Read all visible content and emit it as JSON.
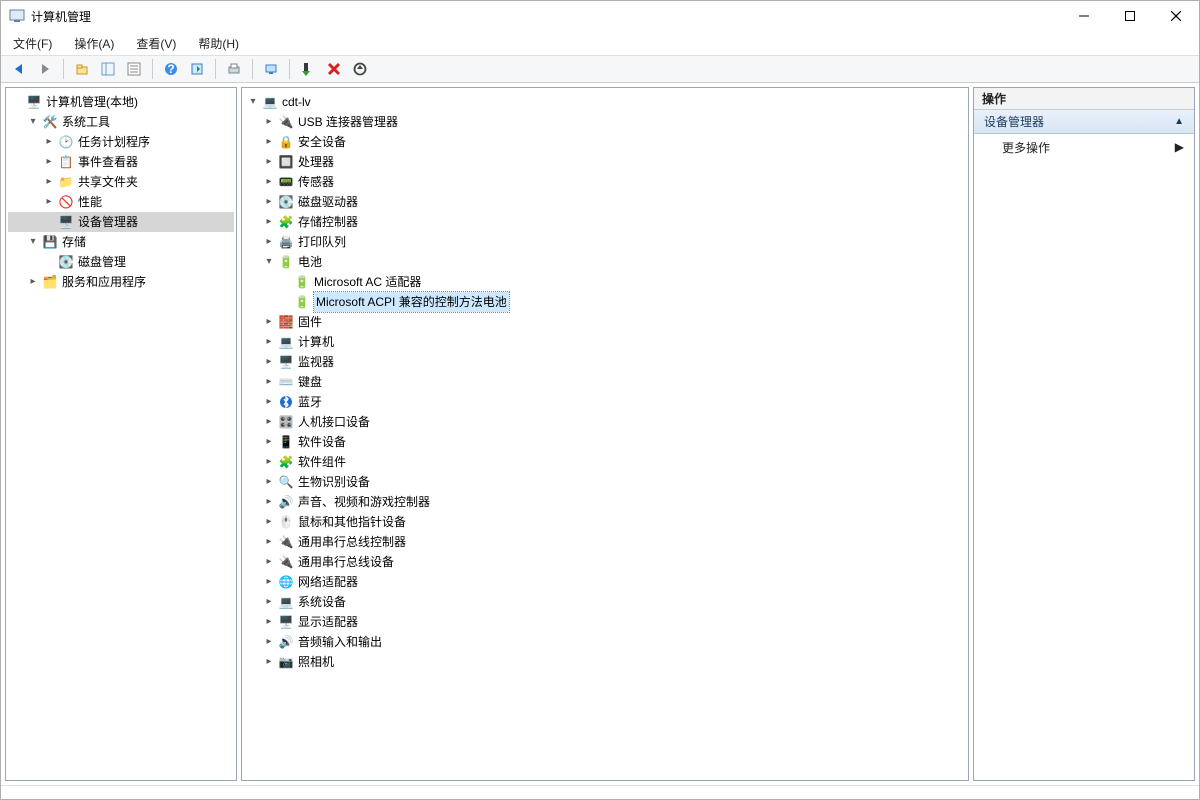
{
  "window": {
    "title": "计算机管理"
  },
  "menu": {
    "file": "文件(F)",
    "action": "操作(A)",
    "view": "查看(V)",
    "help": "帮助(H)"
  },
  "left_tree": {
    "root": "计算机管理(本地)",
    "system_tools": "系统工具",
    "task_scheduler": "任务计划程序",
    "event_viewer": "事件查看器",
    "shared_folders": "共享文件夹",
    "performance": "性能",
    "device_manager": "设备管理器",
    "storage": "存储",
    "disk_management": "磁盘管理",
    "services_apps": "服务和应用程序"
  },
  "center_tree": {
    "computer_name": "cdt-lv",
    "usb_connector_manager": "USB 连接器管理器",
    "security_devices": "安全设备",
    "processors": "处理器",
    "sensors": "传感器",
    "disk_drives": "磁盘驱动器",
    "storage_controllers": "存储控制器",
    "print_queues": "打印队列",
    "batteries": "电池",
    "ms_ac_adapter": "Microsoft AC 适配器",
    "ms_acpi_battery": "Microsoft ACPI 兼容的控制方法电池",
    "firmware": "固件",
    "computer": "计算机",
    "monitors": "监视器",
    "keyboards": "键盘",
    "bluetooth": "蓝牙",
    "hid": "人机接口设备",
    "software_devices": "软件设备",
    "software_components": "软件组件",
    "biometric": "生物识别设备",
    "sound_video_game": "声音、视频和游戏控制器",
    "mice_pointing": "鼠标和其他指针设备",
    "usb_controllers": "通用串行总线控制器",
    "usb_devices": "通用串行总线设备",
    "network_adapters": "网络适配器",
    "system_devices": "系统设备",
    "display_adapters": "显示适配器",
    "audio_io": "音频输入和输出",
    "cameras": "照相机"
  },
  "actions": {
    "header": "操作",
    "section": "设备管理器",
    "more": "更多操作"
  }
}
